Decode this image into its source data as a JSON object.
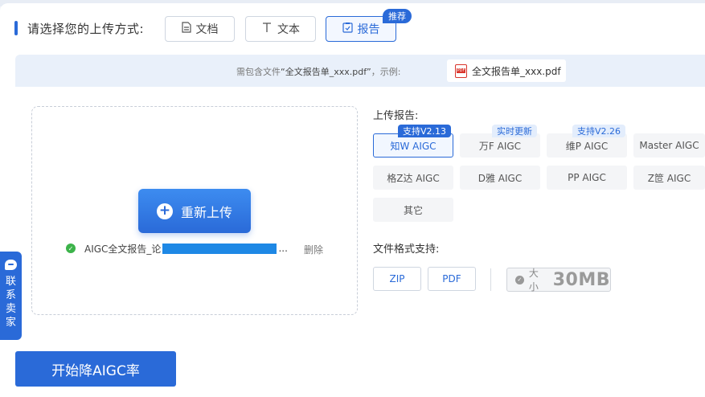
{
  "header": {
    "title": "请选择您的上传方式:",
    "modes": [
      {
        "label": "文档",
        "icon": "document-icon"
      },
      {
        "label": "文本",
        "icon": "text-icon"
      },
      {
        "label": "报告",
        "icon": "report-icon",
        "active": true
      }
    ],
    "recommend_badge": "推荐"
  },
  "info": {
    "hint_prefix": "需包含文件",
    "hint_file": "“全文报告单_xxx.pdf”",
    "hint_suffix": "，示例:",
    "sample_file": "全文报告单_xxx.pdf",
    "sample_icon_text": "PDF"
  },
  "upload": {
    "reupload_label": "重新上传",
    "file_name": "AIGC全文报告_论",
    "ellipsis": "...",
    "delete_label": "删除"
  },
  "report": {
    "label": "上传报告:",
    "options": [
      {
        "label": "知W AIGC",
        "active": true,
        "tag": "支持V2.13",
        "tag_style": "solid"
      },
      {
        "label": "万F AIGC",
        "tag": "实时更新",
        "tag_style": "light"
      },
      {
        "label": "维P AIGC",
        "tag": "支持V2.26",
        "tag_style": "light"
      },
      {
        "label": "Master AIGC"
      },
      {
        "label": "格Z达 AIGC"
      },
      {
        "label": "D雅 AIGC"
      },
      {
        "label": "PP AIGC"
      },
      {
        "label": "Z笸 AIGC"
      },
      {
        "label": "其它"
      }
    ]
  },
  "format": {
    "label": "文件格式支持:",
    "types": [
      "ZIP",
      "PDF"
    ],
    "size_label": "大小",
    "size_value": "30MB"
  },
  "contact": {
    "label": "联系卖家"
  },
  "start_button": "开始降AIGC率",
  "colors": {
    "accent": "#2a6ad8",
    "success": "#3cb34a",
    "pdf_red": "#d9342b"
  }
}
